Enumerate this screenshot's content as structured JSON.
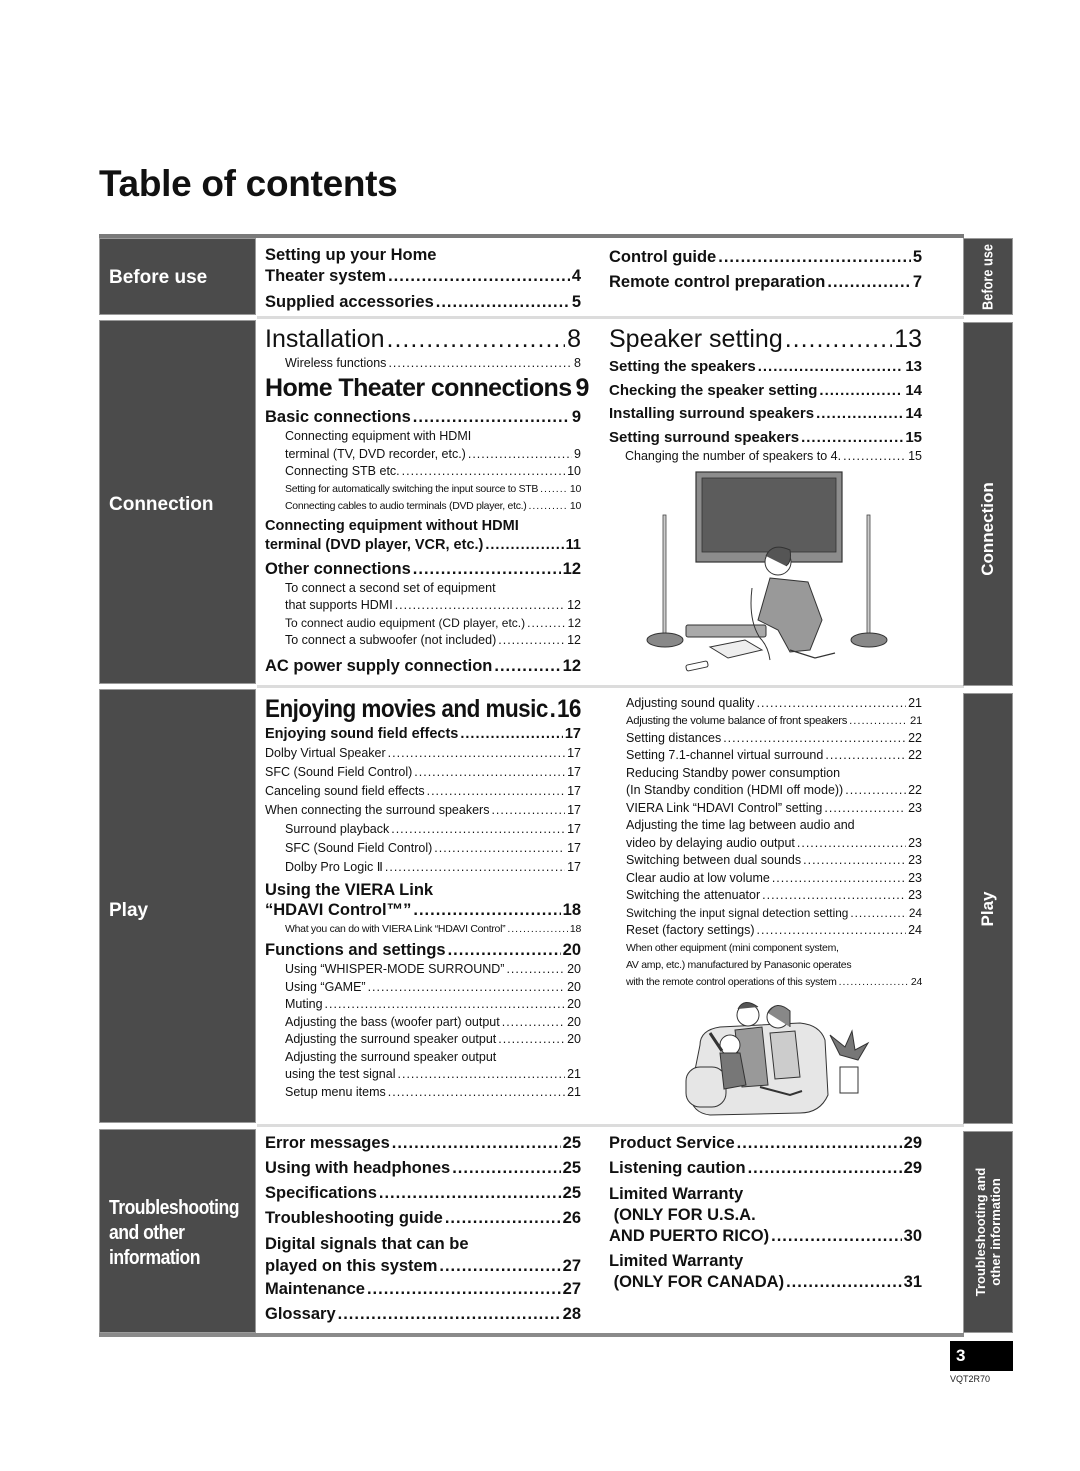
{
  "title": "Table of contents",
  "sections": {
    "before_use": {
      "label": "Before use",
      "side_tab": "Before use",
      "left": [
        {
          "text": "Setting up your Home"
        },
        {
          "text": "Theater system",
          "page": "4"
        },
        {
          "text": "Supplied accessories",
          "page": "5"
        }
      ],
      "right": [
        {
          "text": "Control guide",
          "page": "5"
        },
        {
          "text": "Remote control preparation",
          "page": "7"
        }
      ]
    },
    "connection": {
      "label": "Connection",
      "side_tab": "Connection",
      "installation": {
        "text": "Installation",
        "page": "8"
      },
      "wireless": {
        "text": "Wireless functions",
        "page": "8"
      },
      "home_theater": {
        "text": "Home Theater connections",
        "page": "9"
      },
      "basic": {
        "text": "Basic connections",
        "page": "9"
      },
      "basic_items": [
        {
          "text": "Connecting equipment with HDMI"
        },
        {
          "text": "terminal (TV, DVD recorder, etc.)",
          "page": "9"
        },
        {
          "text": "Connecting STB etc.",
          "page": "10"
        },
        {
          "text": "Setting for automatically switching the input source to STB",
          "page": "10"
        },
        {
          "text": "Connecting cables to audio terminals (DVD player, etc.)",
          "page": "10"
        }
      ],
      "without_hdmi_1": "Connecting equipment without HDMI",
      "without_hdmi_2": {
        "text": "terminal (DVD player, VCR, etc.)",
        "page": "11"
      },
      "other": {
        "text": "Other connections",
        "page": "12"
      },
      "other_items": [
        {
          "text": "To connect a second set of equipment"
        },
        {
          "text": "that supports HDMI",
          "page": "12"
        },
        {
          "text": "To connect audio equipment (CD player, etc.)",
          "page": "12"
        },
        {
          "text": "To connect a subwoofer (not included)",
          "page": "12"
        }
      ],
      "ac_power": {
        "text": "AC power supply connection",
        "page": "12"
      },
      "speaker_setting": {
        "text": "Speaker setting",
        "page": "13"
      },
      "speaker_items": [
        {
          "text": "Setting the speakers",
          "page": "13"
        },
        {
          "text": "Checking the speaker setting",
          "page": "14"
        },
        {
          "text": "Installing surround speakers",
          "page": "14"
        },
        {
          "text": "Setting surround speakers",
          "page": "15"
        }
      ],
      "speaker_sub": {
        "text": "Changing the number of speakers to 4.",
        "page": "15"
      },
      "illustration": "man-connecting-tv-illustration"
    },
    "play": {
      "label": "Play",
      "side_tab": "Play",
      "enjoying": {
        "text": "Enjoying movies and music",
        "page": "16"
      },
      "sound_field": {
        "text": "Enjoying sound field effects",
        "page": "17"
      },
      "sound_items": [
        {
          "text": "Dolby Virtual Speaker",
          "page": "17"
        },
        {
          "text": "SFC (Sound Field Control)",
          "page": "17"
        },
        {
          "text": "Canceling sound field effects",
          "page": "17"
        },
        {
          "text": "When connecting the surround speakers",
          "page": "17"
        }
      ],
      "sound_sub": [
        {
          "text": "Surround playback",
          "page": "17"
        },
        {
          "text": "SFC (Sound Field Control)",
          "page": "17"
        },
        {
          "text": "Dolby Pro Logic Ⅱ",
          "page": "17"
        }
      ],
      "viera_1": "Using the VIERA Link",
      "viera_2": {
        "text": "“HDAVI Control™”",
        "page": "18"
      },
      "viera_sub": {
        "text": "What you can do with VIERA Link “HDAVI Control”",
        "page": "18"
      },
      "functions": {
        "text": "Functions and settings",
        "page": "20"
      },
      "function_items": [
        {
          "text": "Using “WHISPER-MODE SURROUND”",
          "page": "20"
        },
        {
          "text": "Using “GAME”",
          "page": "20"
        },
        {
          "text": "Muting",
          "page": "20"
        },
        {
          "text": "Adjusting the bass (woofer part) output",
          "page": "20"
        },
        {
          "text": "Adjusting the surround speaker output",
          "page": "20"
        },
        {
          "text": "Adjusting the surround speaker output"
        },
        {
          "text": "using the test signal",
          "page": "21"
        },
        {
          "text": "Setup menu items",
          "page": "21"
        }
      ],
      "right_items": [
        {
          "text": "Adjusting sound quality",
          "page": "21"
        },
        {
          "text": "Adjusting the volume balance of front speakers",
          "page": "21"
        },
        {
          "text": "Setting distances",
          "page": "22"
        },
        {
          "text": "Setting 7.1-channel virtual surround",
          "page": "22"
        },
        {
          "text": "Reducing Standby power consumption"
        },
        {
          "text": "(In Standby condition (HDMI off mode))",
          "page": "22"
        },
        {
          "text": "VIERA Link “HDAVI Control” setting",
          "page": "23"
        },
        {
          "text": "Adjusting the time lag between audio and"
        },
        {
          "text": "video by delaying audio output",
          "page": "23"
        },
        {
          "text": "Switching between dual sounds",
          "page": "23"
        },
        {
          "text": "Clear audio at low volume",
          "page": "23"
        },
        {
          "text": "Switching the attenuator",
          "page": "23"
        },
        {
          "text": "Switching the input signal detection setting",
          "page": "24"
        },
        {
          "text": "Reset (factory settings)",
          "page": "24"
        },
        {
          "text": "When other equipment (mini component system,"
        },
        {
          "text": "AV amp, etc.) manufactured by Panasonic operates"
        },
        {
          "text": "with the remote control operations of this system",
          "page": "24"
        }
      ],
      "illustration": "family-on-sofa-illustration"
    },
    "troubleshooting": {
      "label_lines": [
        "Troubleshooting",
        "and other",
        "information"
      ],
      "side_tab_lines": [
        "Troubleshooting and",
        "other information"
      ],
      "left": [
        {
          "text": "Error messages",
          "page": "25"
        },
        {
          "text": "Using with headphones",
          "page": "25"
        },
        {
          "text": "Specifications",
          "page": "25"
        },
        {
          "text": "Troubleshooting guide",
          "page": "26"
        },
        {
          "text": "Digital signals that can be"
        },
        {
          "text": "played on this system",
          "page": "27"
        },
        {
          "text": "Maintenance",
          "page": "27"
        },
        {
          "text": "Glossary",
          "page": "28"
        }
      ],
      "right": [
        {
          "text": "Product Service",
          "page": "29"
        },
        {
          "text": "Listening caution",
          "page": "29"
        },
        {
          "text": "Limited Warranty"
        },
        {
          "text": " (ONLY FOR U.S.A."
        },
        {
          "text": "AND PUERTO RICO)",
          "page": "30"
        },
        {
          "text": "Limited Warranty"
        },
        {
          "text": " (ONLY FOR CANADA)",
          "page": "31"
        }
      ]
    }
  },
  "page_number": "3",
  "doc_code": "VQT2R70"
}
